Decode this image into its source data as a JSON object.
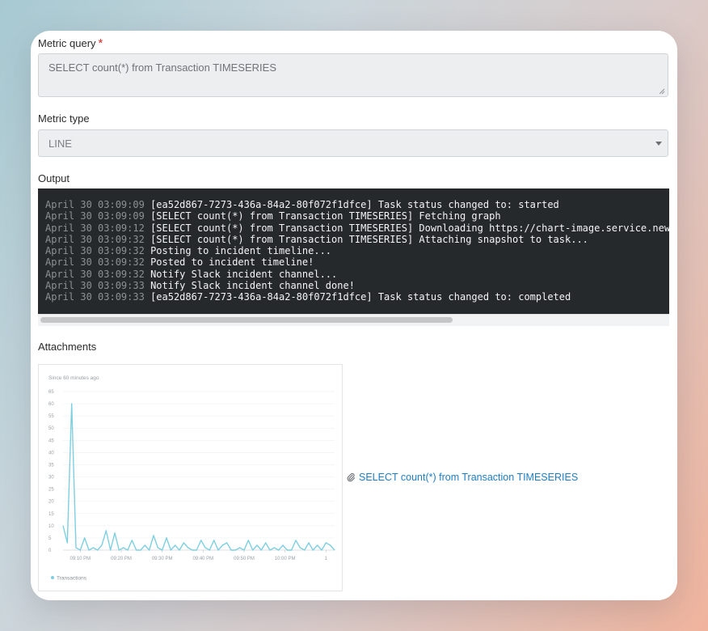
{
  "form": {
    "metric_query_label": "Metric query",
    "required_mark": "*",
    "metric_query_value": "SELECT count(*) from Transaction TIMESERIES",
    "metric_type_label": "Metric type",
    "metric_type_value": "LINE",
    "output_label": "Output",
    "attachments_label": "Attachments"
  },
  "output": {
    "lines": [
      {
        "time": "April 30 03:09:09",
        "text": "[ea52d867-7273-436a-84a2-80f072f1dfce] Task status changed to: started"
      },
      {
        "time": "April 30 03:09:09",
        "text": "[SELECT count(*) from Transaction TIMESERIES] Fetching graph"
      },
      {
        "time": "April 30 03:09:12",
        "text": "[SELECT count(*) from Transaction TIMESERIES] Downloading https://chart-image.service.newr"
      },
      {
        "time": "April 30 03:09:32",
        "text": "[SELECT count(*) from Transaction TIMESERIES] Attaching snapshot to task..."
      },
      {
        "time": "April 30 03:09:32",
        "text": "Posting to incident timeline..."
      },
      {
        "time": "April 30 03:09:32",
        "text": "Posted to incident timeline!"
      },
      {
        "time": "April 30 03:09:32",
        "text": "Notify Slack incident channel..."
      },
      {
        "time": "April 30 03:09:33",
        "text": "Notify Slack incident channel done!"
      },
      {
        "time": "April 30 03:09:33",
        "text": "[ea52d867-7273-436a-84a2-80f072f1dfce] Task status changed to: completed"
      }
    ]
  },
  "attachment": {
    "link_text": "SELECT count(*) from Transaction TIMESERIES",
    "link_color": "#1f7dc3",
    "icon": "paperclip-icon"
  },
  "chart_data": {
    "type": "line",
    "title": "Since 60 minutes ago",
    "ylim": [
      0,
      65
    ],
    "yticks": [
      0,
      5,
      10,
      15,
      20,
      25,
      30,
      35,
      40,
      45,
      50,
      55,
      60,
      65
    ],
    "xlim": [
      0,
      63
    ],
    "x_tick_labels": [
      "09:10 PM",
      "09:20 PM",
      "09:30 PM",
      "09:40 PM",
      "09:50 PM",
      "10:00 PM",
      "1"
    ],
    "x_tick_positions": [
      4,
      13.5,
      23,
      32.5,
      42,
      51.5,
      61
    ],
    "legend": [
      "Transactions"
    ],
    "legend_position": "bottom-left",
    "grid": true,
    "series": [
      {
        "name": "Transactions",
        "color": "#7fcfe0",
        "x": [
          0,
          1,
          2,
          3,
          4,
          5,
          6,
          7,
          8,
          9,
          10,
          11,
          12,
          13,
          14,
          15,
          16,
          17,
          18,
          19,
          20,
          21,
          22,
          23,
          24,
          25,
          26,
          27,
          28,
          29,
          30,
          31,
          32,
          33,
          34,
          35,
          36,
          37,
          38,
          39,
          40,
          41,
          42,
          43,
          44,
          45,
          46,
          47,
          48,
          49,
          50,
          51,
          52,
          53,
          54,
          55,
          56,
          57,
          58,
          59,
          60,
          61,
          62,
          63
        ],
        "y": [
          10,
          3,
          60,
          1,
          0,
          5,
          0,
          1,
          0,
          2,
          8,
          0,
          7,
          0,
          1,
          0,
          4,
          0,
          0,
          2,
          0,
          6,
          1,
          0,
          5,
          0,
          2,
          0,
          3,
          1,
          0,
          0,
          4,
          1,
          0,
          4,
          0,
          2,
          3,
          0,
          0,
          1,
          0,
          4,
          0,
          2,
          0,
          3,
          0,
          1,
          0,
          2,
          0,
          0,
          4,
          1,
          0,
          3,
          0,
          2,
          0,
          3,
          2,
          0
        ]
      }
    ]
  }
}
